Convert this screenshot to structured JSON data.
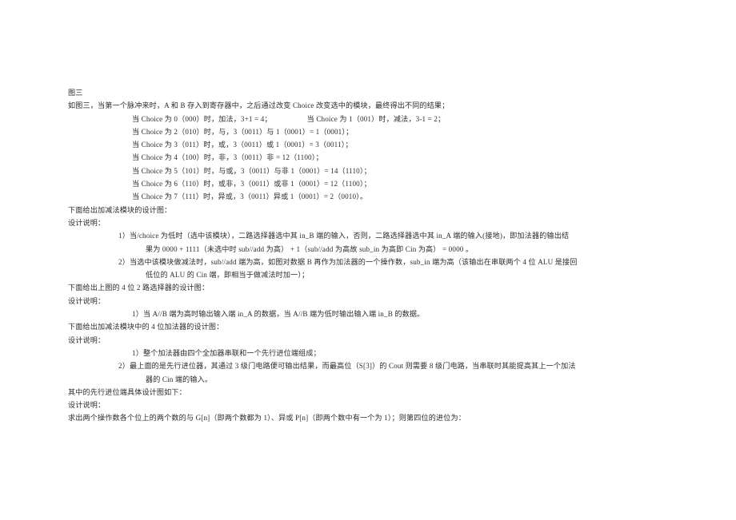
{
  "document": {
    "figure_caption": "图三",
    "intro": "如图三，当第一个脉冲来时，A 和 B 存入到寄存器中，之后通过改变 Choice 改变选中的模块，最终得出不同的结果；",
    "choice_table": {
      "row_first_left": "当 Choice 为 0（000）时，加法，3+1 = 4；",
      "row_first_right": "当 Choice 为 1（001）时，减法，3-1 = 2；",
      "rows": [
        "当 Choice 为 2（010）时，与，3（0011）与 1（0001）= 1（0001）；",
        "当 Choice 为 3（011）时，或，3（0011）或 1（0001）= 3（0011）；",
        "当 Choice 为 4（100）时，非，3（0011）非 = 12（1100）；",
        "当 Choice 为 5（101）时，与或，3（0011）与非 1（0001）= 14（1110）；",
        "当 Choice 为 6（110）时，或非，3（0011）或非 1（0001）= 12（1100）；",
        "当 Choice 为 7（111）时，异或，3（0011）异或 1（0001）= 2（0010）。"
      ]
    },
    "sections": [
      {
        "heading": "下面给出加减法模块的设计图：",
        "subheading": "设计说明：",
        "items": [
          {
            "num": "1）",
            "line1": "当/choice 为低时（选中该模块），二路选择器选中其 in_B 端的输入，否则，二路选择器选中其 in_A 端的输入(接地)，即加法器的输出结",
            "line2": "果为 0000 + 1111（未选中时 sub//add 为高） + 1（sub//add 为高故 sub_in 为高即 Cin 为高）  = 0000 。"
          },
          {
            "num": "2）",
            "line1": "当选中该模块做减法时，sub//add 端为高，如图对数据 B 再作为加法器的一个操作数，sub_in 端为高（该输出在串联两个 4 位 ALU 是接回",
            "line2": "低位的 ALU 的 Cin 端，即相当于做减法时加一）；"
          }
        ]
      },
      {
        "heading": "下面给出上图的 4 位 2 路选择器的设计图：",
        "subheading": "设计说明：",
        "items": [
          {
            "num": "1）",
            "line1": "当 A//B 端为高时输出输入端 in_A 的数据，当 A//B 端为低时输出输入端 in_B 的数据。",
            "line2": ""
          }
        ]
      },
      {
        "heading": "下面给出加减法模块中的 4 位加法器的设计图：",
        "subheading": "设计说明：",
        "items": [
          {
            "num": "1）",
            "line1": "整个加法器由四个全加器串联和一个先行进位端组成；",
            "line2": ""
          },
          {
            "num": "2）",
            "line1": "最上面的是先行进位器，其通过 3 级门电路便可输出结果，而最高位（S[3]）的 Cout 则需要 8 级门电路，当串联时其能提高其上一个加法",
            "line2": "器的 Cin 端的输入。"
          }
        ]
      }
    ],
    "closing": {
      "heading": "其中的先行进位端具体设计图如下：",
      "subheading": "设计说明：",
      "paragraph": "求出两个操作数各个位上的两个数的与 G[n]（即两个数都为 1）、异或 P[n]（即两个数中有一个为 1）；则第四位的进位为："
    }
  }
}
